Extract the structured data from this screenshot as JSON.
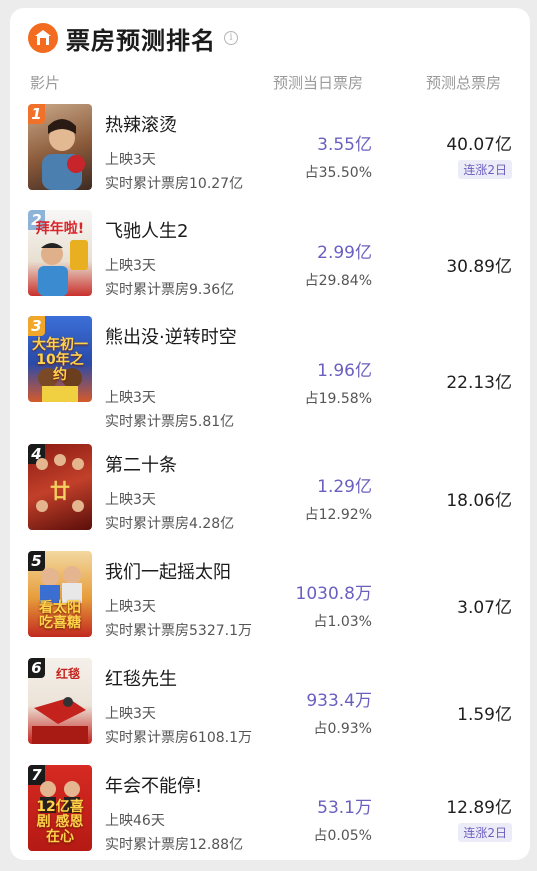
{
  "header": {
    "title": "票房预测排名",
    "info_glyph": "i"
  },
  "columns": {
    "film": "影片",
    "day": "预测当日票房",
    "total": "预测总票房"
  },
  "colors": {
    "accent": "#6a5fbf",
    "logo": "#f26b1f"
  },
  "movies": [
    {
      "rank": "1",
      "name": "热辣滚烫",
      "days": "上映3天",
      "cumulative": "实时累计票房10.27亿",
      "day_box": "3.55亿",
      "day_share": "占35.50%",
      "total": "40.07亿",
      "streak": "连涨2日"
    },
    {
      "rank": "2",
      "name": "飞驰人生2",
      "days": "上映3天",
      "cumulative": "实时累计票房9.36亿",
      "day_box": "2.99亿",
      "day_share": "占29.84%",
      "total": "30.89亿"
    },
    {
      "rank": "3",
      "name": "熊出没·逆转时空",
      "days": "上映3天",
      "cumulative": "实时累计票房5.81亿",
      "day_box": "1.96亿",
      "day_share": "占19.58%",
      "total": "22.13亿"
    },
    {
      "rank": "4",
      "name": "第二十条",
      "days": "上映3天",
      "cumulative": "实时累计票房4.28亿",
      "day_box": "1.29亿",
      "day_share": "占12.92%",
      "total": "18.06亿"
    },
    {
      "rank": "5",
      "name": "我们一起摇太阳",
      "days": "上映3天",
      "cumulative": "实时累计票房5327.1万",
      "day_box": "1030.8万",
      "day_share": "占1.03%",
      "total": "3.07亿"
    },
    {
      "rank": "6",
      "name": "红毯先生",
      "days": "上映3天",
      "cumulative": "实时累计票房6108.1万",
      "day_box": "933.4万",
      "day_share": "占0.93%",
      "total": "1.59亿"
    },
    {
      "rank": "7",
      "name": "年会不能停!",
      "days": "上映46天",
      "cumulative": "实时累计票房12.88亿",
      "day_box": "53.1万",
      "day_share": "占0.05%",
      "total": "12.89亿",
      "streak": "连涨2日"
    }
  ],
  "posters": [
    {
      "text": "",
      "icon": "poster-1-image"
    },
    {
      "text": "拜年啦!",
      "icon": "poster-2-image"
    },
    {
      "text": "大年初一 10年之约",
      "icon": "poster-3-image"
    },
    {
      "text": "",
      "icon": "poster-4-image"
    },
    {
      "text": "看太阳 吃喜糖",
      "icon": "poster-5-image"
    },
    {
      "text": "",
      "icon": "poster-6-image"
    },
    {
      "text": "12亿喜剧 感恩在心",
      "icon": "poster-7-image"
    }
  ]
}
